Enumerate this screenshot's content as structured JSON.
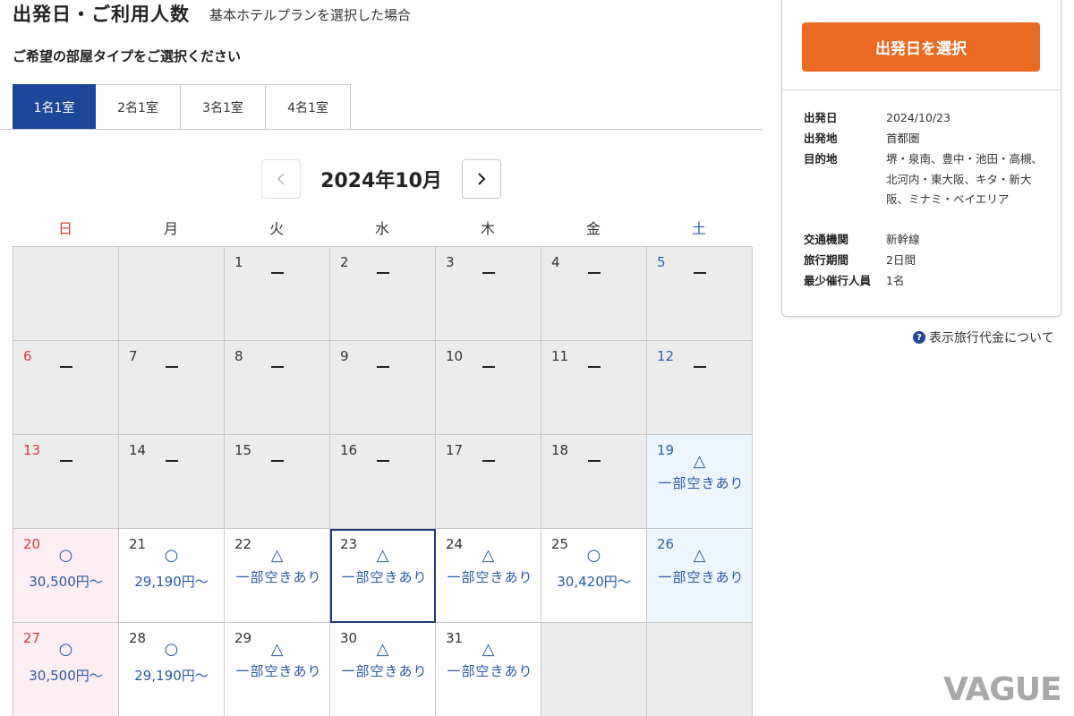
{
  "header": {
    "title": "出発日・ご利用人数",
    "subtitle": "基本ホテルプランを選択した場合"
  },
  "room_prompt": "ご希望の部屋タイプをご選択ください",
  "tabs": [
    {
      "label": "1名1室",
      "active": true
    },
    {
      "label": "2名1室",
      "active": false
    },
    {
      "label": "3名1室",
      "active": false
    },
    {
      "label": "4名1室",
      "active": false
    }
  ],
  "calendar": {
    "month_label": "2024年10月",
    "prev_icon": "chevron-left-icon",
    "next_icon": "chevron-right-icon",
    "weekdays": [
      "日",
      "月",
      "火",
      "水",
      "木",
      "金",
      "土"
    ],
    "leading_blanks": 2,
    "trailing_blanks": 2,
    "partial_text": "一部空きあり",
    "days": [
      {
        "d": "1",
        "status": "none"
      },
      {
        "d": "2",
        "status": "none"
      },
      {
        "d": "3",
        "status": "none"
      },
      {
        "d": "4",
        "status": "none"
      },
      {
        "d": "5",
        "status": "none"
      },
      {
        "d": "6",
        "status": "none"
      },
      {
        "d": "7",
        "status": "none"
      },
      {
        "d": "8",
        "status": "none"
      },
      {
        "d": "9",
        "status": "none"
      },
      {
        "d": "10",
        "status": "none"
      },
      {
        "d": "11",
        "status": "none"
      },
      {
        "d": "12",
        "status": "none"
      },
      {
        "d": "13",
        "status": "none"
      },
      {
        "d": "14",
        "status": "none"
      },
      {
        "d": "15",
        "status": "none"
      },
      {
        "d": "16",
        "status": "none"
      },
      {
        "d": "17",
        "status": "none"
      },
      {
        "d": "18",
        "status": "none"
      },
      {
        "d": "19",
        "status": "partial",
        "mark": "△"
      },
      {
        "d": "20",
        "status": "available",
        "mark": "○",
        "price": "30,500円〜"
      },
      {
        "d": "21",
        "status": "available",
        "mark": "○",
        "price": "29,190円〜"
      },
      {
        "d": "22",
        "status": "partial",
        "mark": "△"
      },
      {
        "d": "23",
        "status": "partial",
        "mark": "△",
        "selected": true
      },
      {
        "d": "24",
        "status": "partial",
        "mark": "△"
      },
      {
        "d": "25",
        "status": "available",
        "mark": "○",
        "price": "30,420円〜"
      },
      {
        "d": "26",
        "status": "partial",
        "mark": "△"
      },
      {
        "d": "27",
        "status": "available",
        "mark": "○",
        "price": "30,500円〜"
      },
      {
        "d": "28",
        "status": "available",
        "mark": "○",
        "price": "29,190円〜"
      },
      {
        "d": "29",
        "status": "partial",
        "mark": "△"
      },
      {
        "d": "30",
        "status": "partial",
        "mark": "△"
      },
      {
        "d": "31",
        "status": "partial",
        "mark": "△"
      }
    ]
  },
  "panel": {
    "cta_label": "出発日を選択",
    "info": [
      {
        "label": "出発日",
        "value": "2024/10/23"
      },
      {
        "label": "出発地",
        "value": "首都圏"
      },
      {
        "label": "目的地",
        "value": "堺・泉南、豊中・池田・高槻、北河内・東大阪、キタ・新大阪、ミナミ・ベイエリア"
      },
      {
        "label": "交通機関",
        "value": "新幹線"
      },
      {
        "label": "旅行期間",
        "value": "2日間"
      },
      {
        "label": "最少催行人員",
        "value": "1名"
      }
    ]
  },
  "help_link": "表示旅行代金について",
  "watermark": "VAGUE",
  "colors": {
    "primary": "#1e4799",
    "cta": "#ea6a21",
    "sunday": "#d6383a",
    "saturday": "#2d5fa8",
    "availability": "#2b57a5"
  }
}
